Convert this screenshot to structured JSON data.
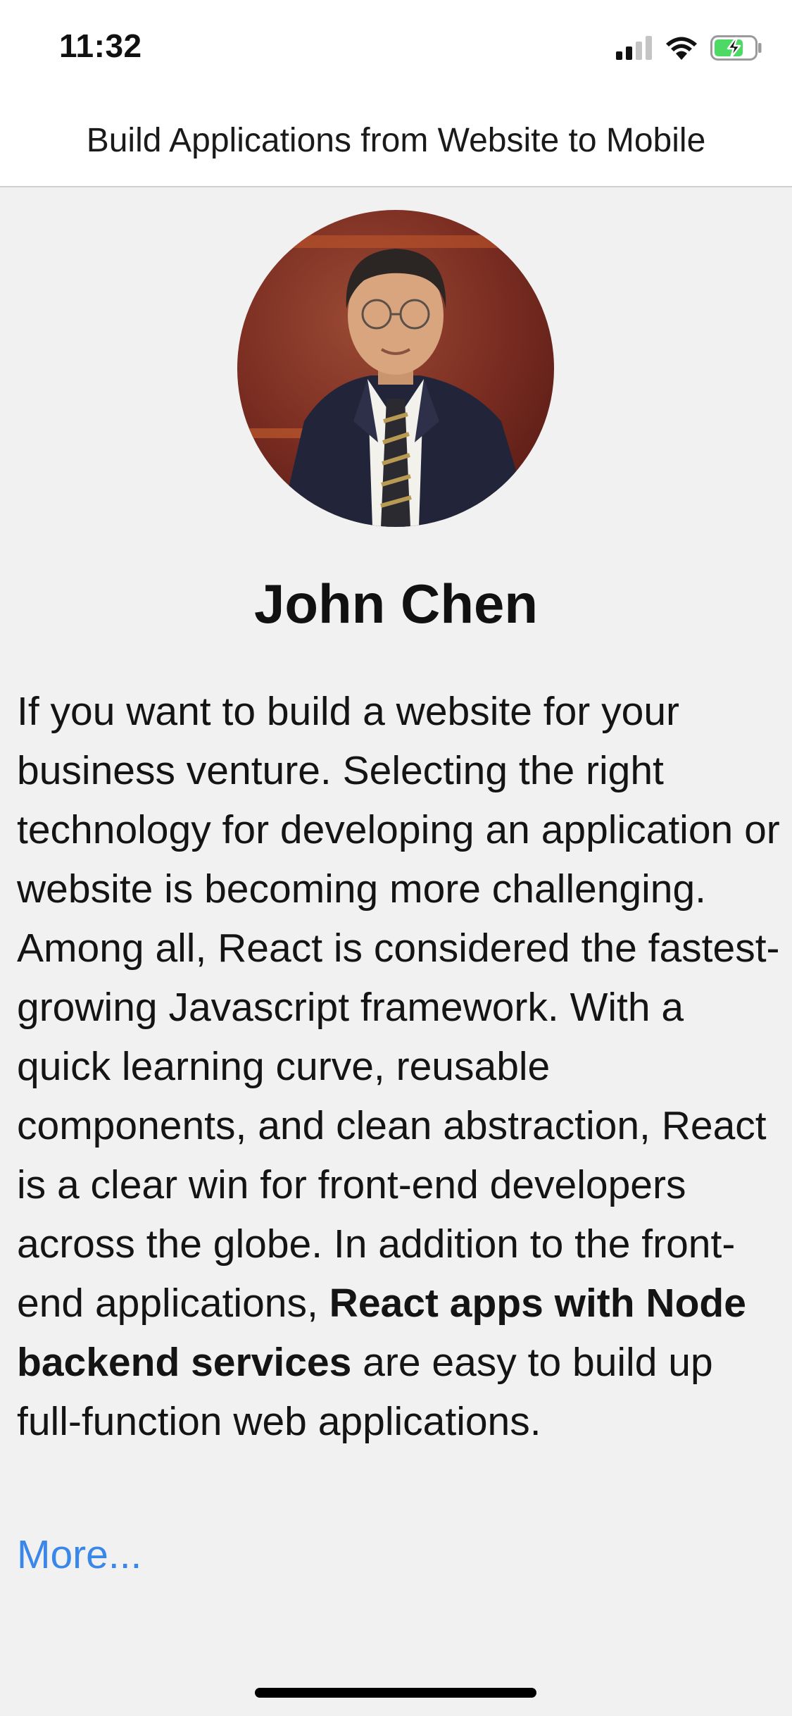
{
  "status_bar": {
    "time": "11:32",
    "icons": [
      "cellular-signal-icon",
      "wifi-icon",
      "battery-charging-icon"
    ]
  },
  "nav": {
    "title": "Build Applications from Website to Mobile"
  },
  "profile": {
    "name": "John Chen",
    "bio_part1": "If you want to build a website for your business venture. Selecting the right technology for developing an application or website is becoming more challenging. Among all, React is considered the fastest-growing Javascript framework. With a quick learning curve, reusable components, and clean abstraction, React is a clear win for front-end developers across the globe. In addition to the front-end applications, ",
    "bio_bold": "React apps with Node backend services",
    "bio_part2": " are easy to build up full-function web applications.",
    "more_label": "More..."
  },
  "colors": {
    "link": "#3a87ea",
    "background": "#f1f1f2",
    "battery": "#4cd964"
  }
}
